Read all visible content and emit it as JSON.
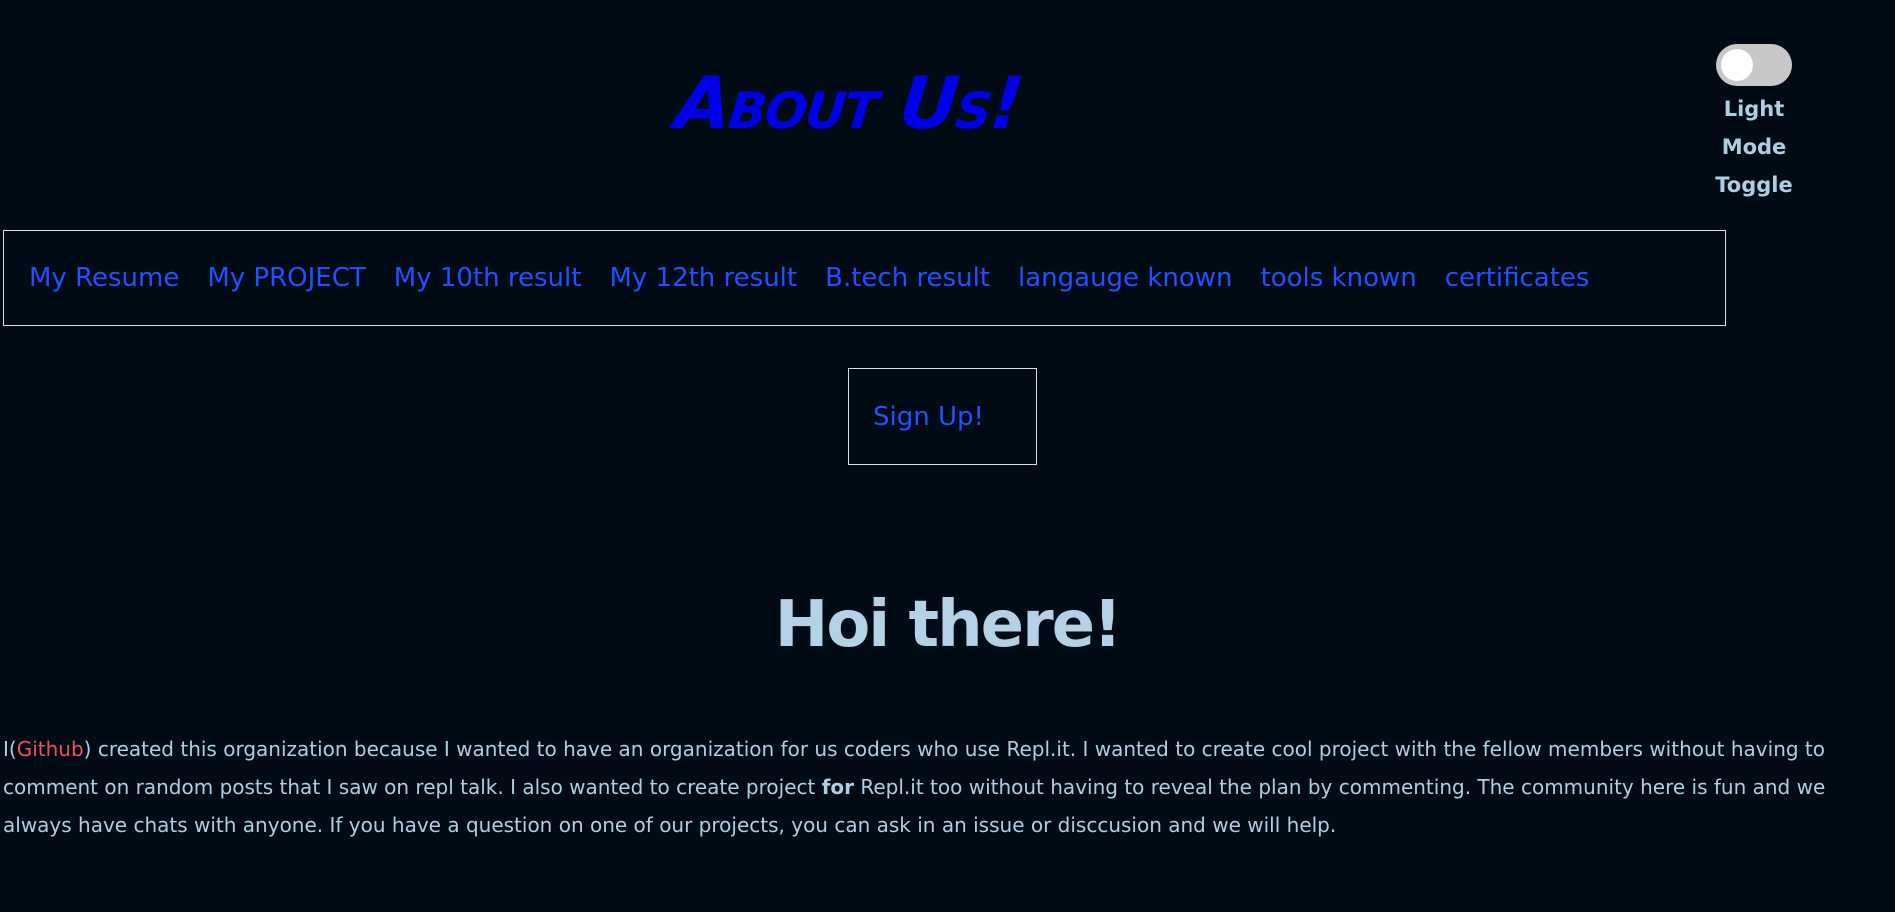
{
  "header": {
    "title": "About Us!"
  },
  "theme_toggle": {
    "label": "Light Mode Toggle",
    "state": "off"
  },
  "nav": {
    "items": [
      {
        "label": "My Resume"
      },
      {
        "label": "My PROJECT"
      },
      {
        "label": "My 10th result"
      },
      {
        "label": "My 12th result"
      },
      {
        "label": "B.tech result"
      },
      {
        "label": "langauge known"
      },
      {
        "label": "tools known"
      },
      {
        "label": "certificates"
      }
    ]
  },
  "signup": {
    "label": "Sign Up!"
  },
  "main": {
    "heading": "Hoi there!",
    "paragraph": {
      "prefix": "I(",
      "github_link": "Github",
      "part1": ") created this organization because I wanted to have an organization for us coders who use Repl.it. I wanted to create cool project with the fellow members without having to comment on random posts that I saw on repl talk. I also wanted to create project ",
      "bold_word": "for",
      "part2": " Repl.it too without having to reveal the plan by commenting. The community here is fun and we always have chats with anyone. If you have a question on one of our projects, you can ask in an issue or disccusion and we will help."
    }
  },
  "colors": {
    "background": "#000b15",
    "title": "#0000e8",
    "link": "#1f51ff",
    "text": "#aecfe3",
    "github_link": "#f0505c",
    "border": "#d7dde2"
  }
}
